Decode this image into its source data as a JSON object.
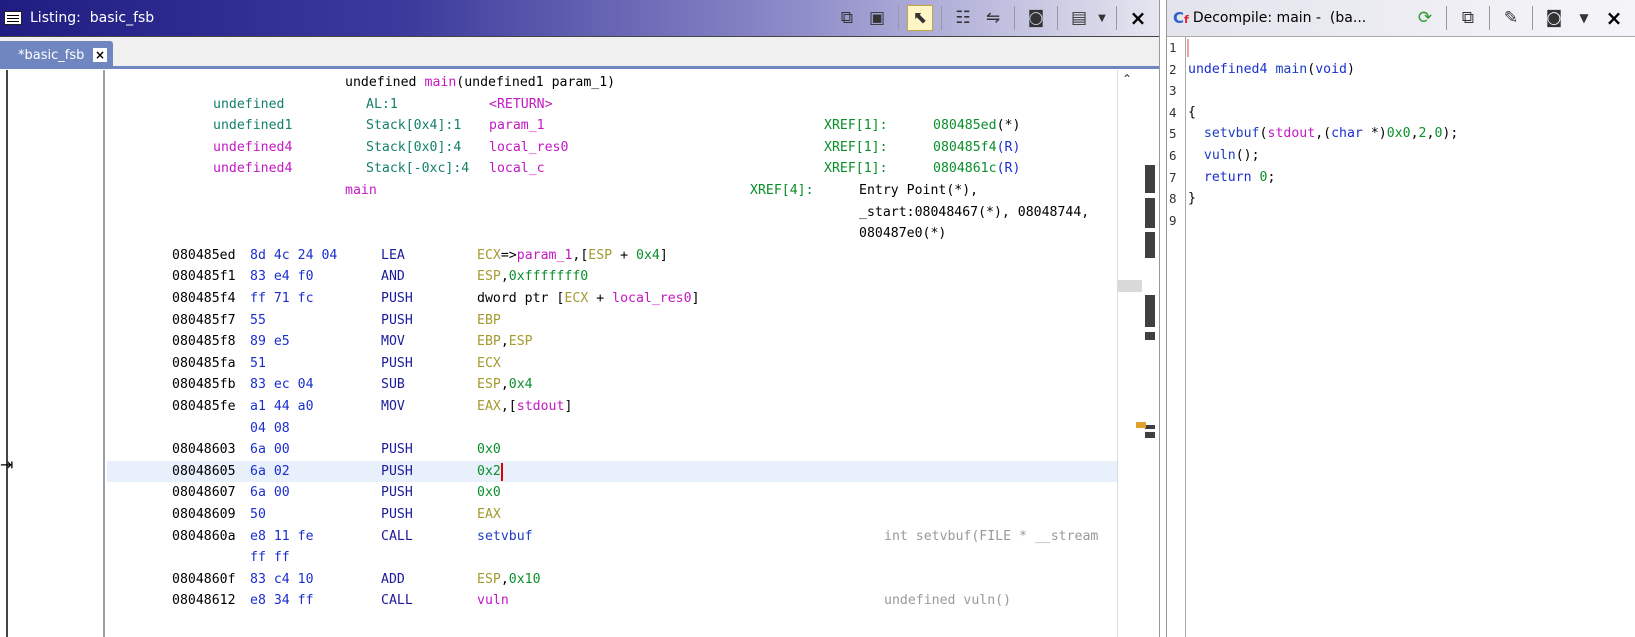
{
  "listing": {
    "title": "Listing:  basic_fsb",
    "tab_label": "*basic_fsb",
    "tab_close": "×",
    "close_label": "×",
    "header": {
      "signature": [
        "undefined ",
        "main",
        "(undefined1 param_1)"
      ],
      "params": [
        {
          "type": "undefined",
          "storage": "AL:1",
          "name": "<RETURN>",
          "xref": "",
          "addr": "",
          "suffix": ""
        },
        {
          "type": "undefined1",
          "storage": "Stack[0x4]:1",
          "name": "param_1",
          "xref": "XREF[1]:",
          "addr": "080485ed",
          "suffix": "(*)"
        },
        {
          "type": "undefined4",
          "storage": "Stack[0x0]:4",
          "name": "local_res0",
          "xref": "XREF[1]:",
          "addr": "080485f4",
          "suffix": "(R)"
        },
        {
          "type": "undefined4",
          "storage": "Stack[-0xc]:4",
          "name": "local_c",
          "xref": "XREF[1]:",
          "addr": "0804861c",
          "suffix": "(R)"
        }
      ],
      "label": "main",
      "label_xref": "XREF[4]:",
      "xref_lines": [
        "Entry Point(*),",
        "_start:08048467(*), 08048744,",
        "080487e0(*)"
      ]
    },
    "instructions": [
      {
        "addr": "080485ed",
        "bytes": "8d 4c 24 04",
        "mnem": "LEA",
        "ops": [
          [
            "ECX",
            "reg"
          ],
          [
            "=>",
            "plain"
          ],
          [
            "param_1",
            "var"
          ],
          [
            ",[",
            "plain"
          ],
          [
            "ESP",
            "reg"
          ],
          [
            " + ",
            "plain"
          ],
          [
            "0x4",
            "num"
          ],
          [
            "]",
            "plain"
          ]
        ],
        "comment": ""
      },
      {
        "addr": "080485f1",
        "bytes": "83 e4 f0",
        "mnem": "AND",
        "ops": [
          [
            "ESP",
            "reg"
          ],
          [
            ",",
            "plain"
          ],
          [
            "0xfffffff0",
            "num"
          ]
        ],
        "comment": ""
      },
      {
        "addr": "080485f4",
        "bytes": "ff 71 fc",
        "mnem": "PUSH",
        "ops": [
          [
            "dword ptr [",
            "plain"
          ],
          [
            "ECX",
            "reg"
          ],
          [
            " + ",
            "plain"
          ],
          [
            "local_res0",
            "var"
          ],
          [
            "]",
            "plain"
          ]
        ],
        "comment": ""
      },
      {
        "addr": "080485f7",
        "bytes": "55",
        "mnem": "PUSH",
        "ops": [
          [
            "EBP",
            "reg"
          ]
        ],
        "comment": ""
      },
      {
        "addr": "080485f8",
        "bytes": "89 e5",
        "mnem": "MOV",
        "ops": [
          [
            "EBP",
            "reg"
          ],
          [
            ",",
            "plain"
          ],
          [
            "ESP",
            "reg"
          ]
        ],
        "comment": ""
      },
      {
        "addr": "080485fa",
        "bytes": "51",
        "mnem": "PUSH",
        "ops": [
          [
            "ECX",
            "reg"
          ]
        ],
        "comment": ""
      },
      {
        "addr": "080485fb",
        "bytes": "83 ec 04",
        "mnem": "SUB",
        "ops": [
          [
            "ESP",
            "reg"
          ],
          [
            ",",
            "plain"
          ],
          [
            "0x4",
            "num"
          ]
        ],
        "comment": ""
      },
      {
        "addr": "080485fe",
        "bytes": "a1 44 a0",
        "mnem": "MOV",
        "ops": [
          [
            "EAX",
            "reg"
          ],
          [
            ",[",
            "plain"
          ],
          [
            "stdout",
            "var"
          ],
          [
            "]",
            "plain"
          ]
        ],
        "comment": ""
      },
      {
        "addr": "",
        "bytes": "04 08",
        "mnem": "",
        "ops": [],
        "comment": ""
      },
      {
        "addr": "08048603",
        "bytes": "6a 00",
        "mnem": "PUSH",
        "ops": [
          [
            "0x0",
            "num"
          ]
        ],
        "comment": ""
      },
      {
        "addr": "08048605",
        "bytes": "6a 02",
        "mnem": "PUSH",
        "ops": [
          [
            "0x2",
            "num"
          ]
        ],
        "comment": "",
        "highlight": true
      },
      {
        "addr": "08048607",
        "bytes": "6a 00",
        "mnem": "PUSH",
        "ops": [
          [
            "0x0",
            "num"
          ]
        ],
        "comment": ""
      },
      {
        "addr": "08048609",
        "bytes": "50",
        "mnem": "PUSH",
        "ops": [
          [
            "EAX",
            "reg"
          ]
        ],
        "comment": ""
      },
      {
        "addr": "0804860a",
        "bytes": "e8 11 fe",
        "mnem": "CALL",
        "ops": [
          [
            "setvbuf",
            "func"
          ]
        ],
        "comment": "int setvbuf(FILE * __stream"
      },
      {
        "addr": "",
        "bytes": "ff ff",
        "mnem": "",
        "ops": [],
        "comment": ""
      },
      {
        "addr": "0804860f",
        "bytes": "83 c4 10",
        "mnem": "ADD",
        "ops": [
          [
            "ESP",
            "reg"
          ],
          [
            ",",
            "plain"
          ],
          [
            "0x10",
            "num"
          ]
        ],
        "comment": ""
      },
      {
        "addr": "08048612",
        "bytes": "e8 34 ff",
        "mnem": "CALL",
        "ops": [
          [
            "vuln",
            "var"
          ]
        ],
        "comment": "undefined vuln()"
      }
    ]
  },
  "decompile": {
    "title": "Decompile: main -  (ba...",
    "close_label": "×",
    "lines": [
      {
        "num": "1",
        "tokens": []
      },
      {
        "num": "2",
        "tokens": [
          [
            "undefined4",
            "kw"
          ],
          [
            " ",
            "plain"
          ],
          [
            "main",
            "fn"
          ],
          [
            "(",
            "plain"
          ],
          [
            "void",
            "kw"
          ],
          [
            ")",
            "plain"
          ]
        ]
      },
      {
        "num": "3",
        "tokens": []
      },
      {
        "num": "4",
        "tokens": [
          [
            "{",
            "plain"
          ]
        ]
      },
      {
        "num": "5",
        "tokens": [
          [
            "  ",
            "plain"
          ],
          [
            "setvbuf",
            "fn"
          ],
          [
            "(",
            "plain"
          ],
          [
            "stdout",
            "var"
          ],
          [
            ",(",
            "plain"
          ],
          [
            "char",
            "kw"
          ],
          [
            " *)",
            "plain"
          ],
          [
            "0x0",
            "num"
          ],
          [
            ",",
            "plain"
          ],
          [
            "2",
            "num"
          ],
          [
            ",",
            "plain"
          ],
          [
            "0",
            "num"
          ],
          [
            ");",
            "plain"
          ]
        ]
      },
      {
        "num": "6",
        "tokens": [
          [
            "  ",
            "plain"
          ],
          [
            "vuln",
            "fn"
          ],
          [
            "();",
            "plain"
          ]
        ]
      },
      {
        "num": "7",
        "tokens": [
          [
            "  ",
            "plain"
          ],
          [
            "return",
            "kw"
          ],
          [
            " ",
            "plain"
          ],
          [
            "0",
            "num"
          ],
          [
            ";",
            "plain"
          ]
        ]
      },
      {
        "num": "8",
        "tokens": [
          [
            "}",
            "plain"
          ]
        ]
      },
      {
        "num": "9",
        "tokens": []
      }
    ]
  },
  "colors": {
    "addr": "#000000",
    "bytes": "#1b2fd0",
    "mnem": "#1b1b9c",
    "reg": "#a39b2f",
    "num": "#0a8f2a",
    "var": "#c418c4",
    "func": "#1e40c0",
    "plain": "#000000",
    "type": "#14806a",
    "comment": "#9a9a9a",
    "kw": "#1b2fd0",
    "fn": "#1e40c0"
  }
}
